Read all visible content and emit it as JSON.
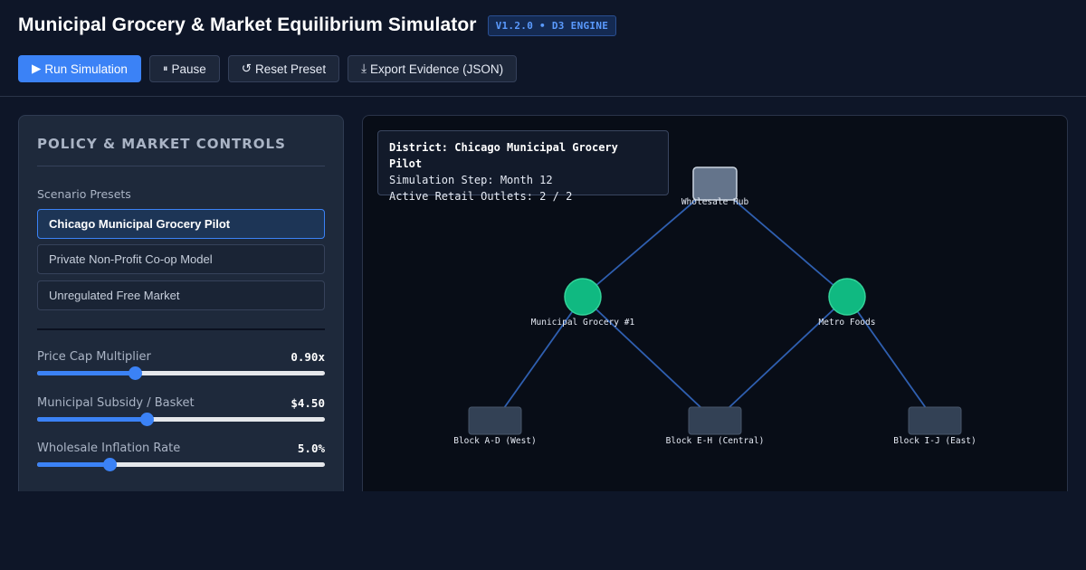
{
  "header": {
    "title": "Municipal Grocery & Market Equilibrium Simulator",
    "badge": "V1.2.0 • D3 ENGINE"
  },
  "toolbar": {
    "run": {
      "icon": "play-icon",
      "glyph": "▶",
      "label": "Run Simulation"
    },
    "pause": {
      "icon": "pause-icon",
      "glyph": "⏸",
      "label": "Pause"
    },
    "reset": {
      "icon": "reset-icon",
      "glyph": "↺",
      "label": "Reset Preset"
    },
    "export": {
      "icon": "download-icon",
      "glyph": "⤓",
      "label": "Export Evidence (JSON)"
    }
  },
  "controls": {
    "heading": "POLICY & MARKET CONTROLS",
    "presets_label": "Scenario Presets",
    "presets": [
      {
        "label": "Chicago Municipal Grocery Pilot",
        "active": true
      },
      {
        "label": "Private Non-Profit Co-op Model",
        "active": false
      },
      {
        "label": "Unregulated Free Market",
        "active": false
      }
    ],
    "sliders": [
      {
        "label": "Price Cap Multiplier",
        "value": "0.90x",
        "fraction": 0.34
      },
      {
        "label": "Municipal Subsidy / Basket",
        "value": "$4.50",
        "fraction": 0.38
      },
      {
        "label": "Wholesale Inflation Rate",
        "value": "5.0%",
        "fraction": 0.25
      }
    ]
  },
  "info": {
    "district": "District: Chicago Municipal Grocery Pilot",
    "step": "Simulation Step: Month 12",
    "outlets": "Active Retail Outlets: 2 / 2"
  },
  "network": {
    "nodes": [
      {
        "id": "hub",
        "label": "Wholesale Hub",
        "kind": "hub"
      },
      {
        "id": "muni",
        "label": "Municipal Grocery #1",
        "kind": "store"
      },
      {
        "id": "metro",
        "label": "Metro Foods",
        "kind": "store"
      },
      {
        "id": "west",
        "label": "Block A-D (West)",
        "kind": "block"
      },
      {
        "id": "central",
        "label": "Block E-H (Central)",
        "kind": "block"
      },
      {
        "id": "east",
        "label": "Block I-J (East)",
        "kind": "block"
      }
    ],
    "links": [
      [
        "hub",
        "muni"
      ],
      [
        "hub",
        "metro"
      ],
      [
        "muni",
        "west"
      ],
      [
        "muni",
        "central"
      ],
      [
        "metro",
        "central"
      ],
      [
        "metro",
        "east"
      ]
    ],
    "colors": {
      "link": "#2f5fb0",
      "store": "#10b981",
      "store_stroke": "#34d399",
      "hub": "#64748b",
      "hub_stroke": "#cbd5e1",
      "block": "#334155",
      "block_stroke": "#475569"
    }
  }
}
